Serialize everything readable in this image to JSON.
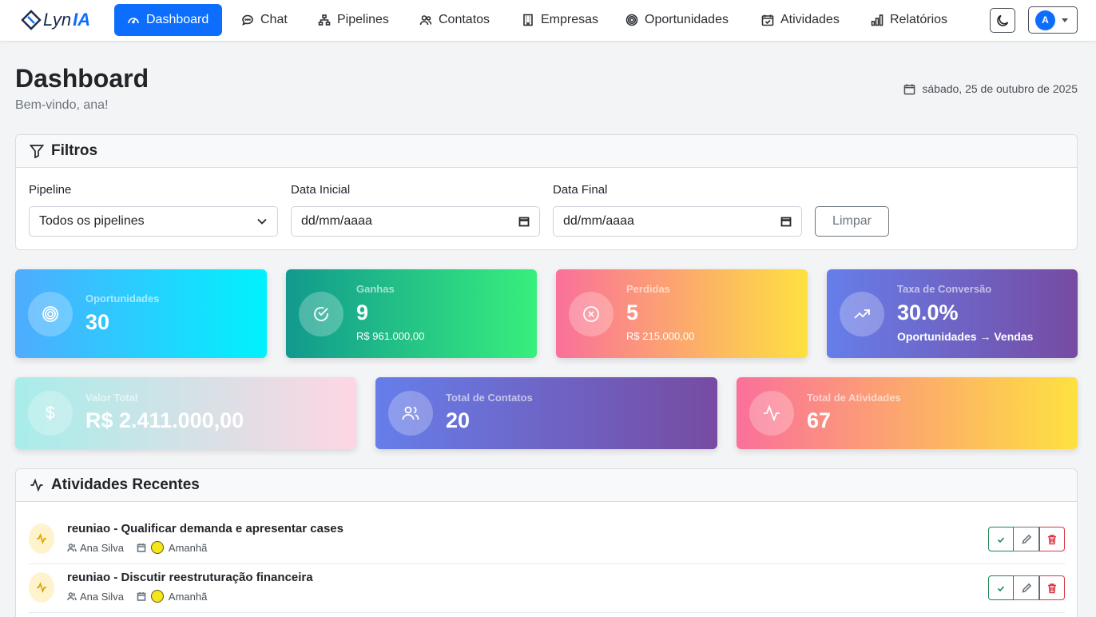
{
  "brand": {
    "part1": "Lyn",
    "part2": "IA"
  },
  "nav": {
    "items": [
      {
        "label": "Dashboard",
        "icon": "gauge-icon",
        "active": true
      },
      {
        "label": "Chat",
        "icon": "chat-icon"
      },
      {
        "label": "Pipelines",
        "icon": "diagram-icon"
      },
      {
        "label": "Contatos",
        "icon": "people-icon"
      },
      {
        "label": "Empresas",
        "icon": "building-icon"
      },
      {
        "label": "Oportunidades",
        "icon": "bullseye-icon"
      },
      {
        "label": "Atividades",
        "icon": "calendar-check-icon"
      },
      {
        "label": "Relatórios",
        "icon": "bar-chart-icon"
      }
    ],
    "theme_icon": "moon-icon",
    "user_initial": "A"
  },
  "header": {
    "title": "Dashboard",
    "subtitle": "Bem-vindo, ana!",
    "date": "sábado, 25 de outubro de 2025"
  },
  "filters": {
    "title": "Filtros",
    "pipeline_label": "Pipeline",
    "pipeline_value": "Todos os pipelines",
    "start_label": "Data Inicial",
    "start_value": "dd/mm/aaaa",
    "end_label": "Data Final",
    "end_value": "dd/mm/aaaa",
    "clear_label": "Limpar"
  },
  "stats": {
    "oportunidades": {
      "label": "Oportunidades",
      "value": "30"
    },
    "ganhas": {
      "label": "Ganhas",
      "value": "9",
      "note": "R$ 961.000,00"
    },
    "perdidas": {
      "label": "Perdidas",
      "value": "5",
      "note": "R$ 215.000,00"
    },
    "conversao": {
      "label": "Taxa de Conversão",
      "value": "30.0%",
      "note": "Oportunidades → Vendas"
    },
    "valor_total": {
      "label": "Valor Total",
      "value": "R$ 2.411.000,00"
    },
    "contatos": {
      "label": "Total de Contatos",
      "value": "20"
    },
    "atividades": {
      "label": "Total de Atividades",
      "value": "67"
    }
  },
  "activities": {
    "title": "Atividades Recentes",
    "items": [
      {
        "title": "reuniao - Qualificar demanda e apresentar cases",
        "owner": "Ana Silva",
        "when": "Amanhã"
      },
      {
        "title": "reuniao - Discutir reestruturação financeira",
        "owner": "Ana Silva",
        "when": "Amanhã"
      }
    ]
  }
}
